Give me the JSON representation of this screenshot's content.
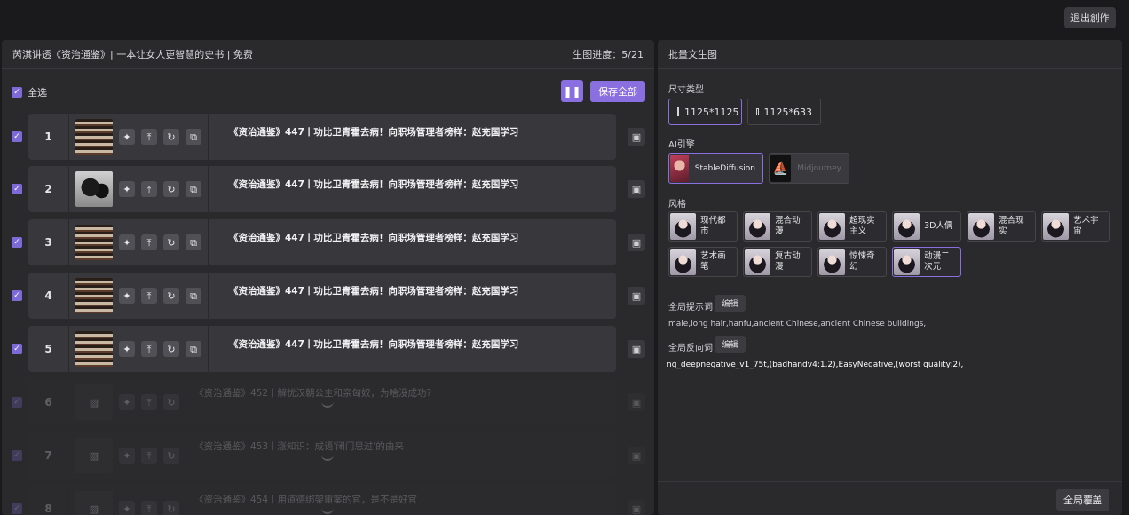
{
  "header": {
    "exit_label": "退出創作"
  },
  "left": {
    "title": "芮淇讲透《资治通鉴》| 一本让女人更智慧的史书 | 免费",
    "progress_label": "生图进度：5/21",
    "select_all_label": "全选",
    "pause_glyph": "❚❚",
    "save_all_label": "保存全部",
    "check_glyph": "✓",
    "rows": [
      {
        "num": "1",
        "title": "《资治通鉴》447丨功比卫青霍去病！向职场管理者榜样：赵充国学习"
      },
      {
        "num": "2",
        "title": "《资治通鉴》447丨功比卫青霍去病！向职场管理者榜样：赵充国学习"
      },
      {
        "num": "3",
        "title": "《资治通鉴》447丨功比卫青霍去病！向职场管理者榜样：赵充国学习"
      },
      {
        "num": "4",
        "title": "《资治通鉴》447丨功比卫青霍去病！向职场管理者榜样：赵充国学习"
      },
      {
        "num": "5",
        "title": "《资治通鉴》447丨功比卫青霍去病！向职场管理者榜样：赵充国学习"
      },
      {
        "num": "6",
        "title": "《资治通鉴》452丨解忧汉朝公主和亲匈奴，为啥没成功?"
      },
      {
        "num": "7",
        "title": "《资治通鉴》453丨涨知识：成语'闭门思过'的由来"
      },
      {
        "num": "8",
        "title": "《资治通鉴》454丨用道德绑架审案的官，是不是好官"
      }
    ],
    "icons": {
      "magic": "✦",
      "upload": "⤒",
      "refresh": "↻",
      "copy": "⧉",
      "save": "▣",
      "image": "▨"
    }
  },
  "right": {
    "title": "批量文生图",
    "size_label": "尺寸类型",
    "sizes": [
      "1125*1125",
      "1125*633"
    ],
    "engine_label": "AI引擎",
    "engines": [
      "StableDiffusion",
      "Midjourney"
    ],
    "mj_glyph": "⛵",
    "style_label": "风格",
    "styles": [
      "现代都市",
      "混合动漫",
      "超现实主义",
      "3D人偶",
      "混合现实",
      "艺术宇宙",
      "艺术画笔",
      "复古动漫",
      "惊悚奇幻",
      "动漫二次元"
    ],
    "prompt_label": "全局提示词",
    "edit_label": "编辑",
    "prompt_text": "male,long hair,hanfu,ancient Chinese,ancient Chinese buildings,",
    "neg_label": "全局反向词",
    "neg_text": "ng_deepnegative_v1_75t,(badhandv4:1.2),EasyNegative,(worst quality:2),",
    "global_btn": "全局覆盖"
  }
}
